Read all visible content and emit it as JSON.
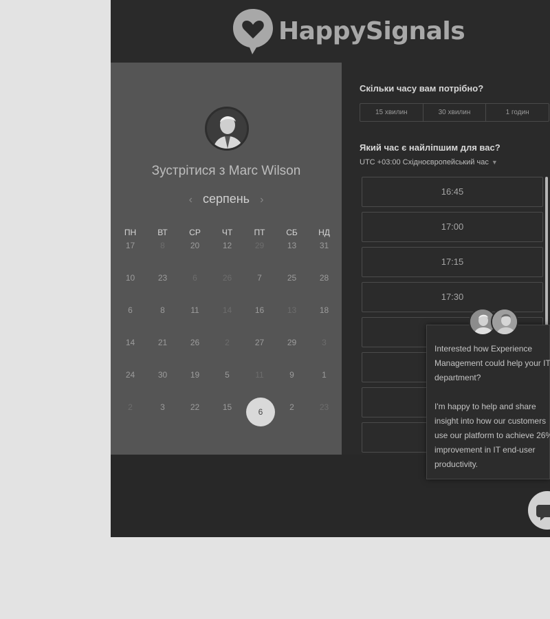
{
  "brand": {
    "name": "HappySignals"
  },
  "calendar": {
    "title": "Зустрітися з Marc Wilson",
    "month": "серпень",
    "prev_arrow": "‹",
    "next_arrow": "›",
    "weekdays": [
      "ПН",
      "ВТ",
      "СР",
      "ЧТ",
      "ПТ",
      "СБ",
      "НД"
    ],
    "weeks": [
      [
        "17",
        "8",
        "20",
        "12",
        "29",
        "13",
        "31"
      ],
      [
        "10",
        "23",
        "6",
        "26",
        "7",
        "25",
        "28"
      ],
      [
        "6",
        "8",
        "11",
        "14",
        "16",
        "13",
        "18"
      ],
      [
        "14",
        "21",
        "26",
        "2",
        "27",
        "29",
        "3"
      ],
      [
        "24",
        "30",
        "19",
        "5",
        "11",
        "9",
        "1"
      ],
      [
        "2",
        "3",
        "22",
        "15",
        "6",
        "2",
        "23"
      ]
    ],
    "selected_day": "6"
  },
  "scheduler": {
    "duration_question": "Скільки часу вам потрібно?",
    "durations": [
      "15 хвилин",
      "30 хвилин",
      "1 годин"
    ],
    "time_question": "Який час є найліпшим для вас?",
    "timezone": "UTC +03:00 Східноєвропейський час",
    "slots": [
      "16:45",
      "17:00",
      "17:15",
      "17:30",
      "",
      "",
      "",
      ""
    ]
  },
  "chat": {
    "message": "Interested how Experience Management could help your IT department?\n\nI'm happy to help and share insight into how our customers use our platform to achieve 26% improvement in IT end-user productivity."
  },
  "colors": {
    "page_bg": "#e3e3e3",
    "frame_bg": "#282828",
    "left_panel": "#555555",
    "selected_day": "#d9d9d9"
  }
}
